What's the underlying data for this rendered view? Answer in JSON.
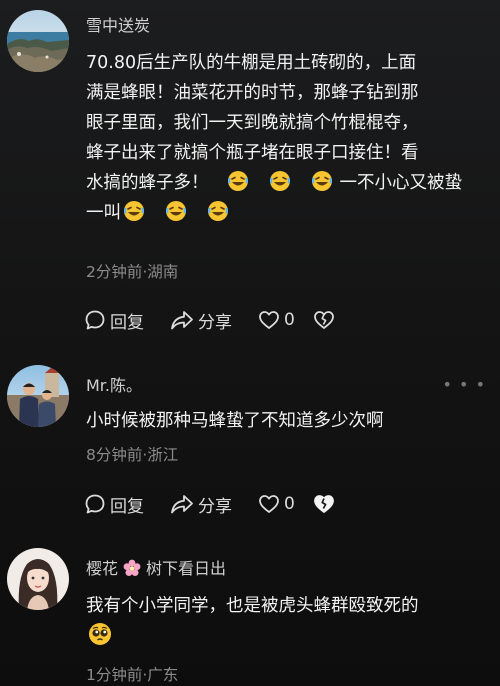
{
  "comments": [
    {
      "username": "雪中送炭",
      "text_lines": [
        "70.80后生产队的牛棚是用土砖砌的，上面",
        "满是蜂眼！油菜花开的时节，那蜂子钻到那",
        "眼子里面，我们一天到晚就搞个竹棍棍夺，",
        "蜂子出来了就搞个瓶子堵在眼子口接住！看"
      ],
      "line5_text": "水搞的蜂子多！",
      "line5_tail": "一不小心又被蛰",
      "line6_text": "一叫",
      "meta": "2分钟前·湖南",
      "reply_label": "回复",
      "share_label": "分享",
      "like_count": "0"
    },
    {
      "username": "Mr.陈。",
      "text": "小时候被那种马蜂蛰了不知道多少次啊",
      "meta": "8分钟前·浙江",
      "reply_label": "回复",
      "share_label": "分享",
      "like_count": "0",
      "more_icon": "ellipsis-icon"
    },
    {
      "username": "樱花",
      "username_tail": "树下看日出",
      "text": "我有个小学同学，也是被虎头蜂群殴致死的",
      "meta": "1分钟前·广东"
    }
  ],
  "emoji_names": [
    "rolling-laughing-emoji",
    "pleading-face-emoji",
    "cherry-blossom-emoji"
  ],
  "colors": {
    "background": "#141414",
    "text": "#f2f2f2",
    "meta": "#8b8b8b",
    "emoji": "#f7c531"
  }
}
